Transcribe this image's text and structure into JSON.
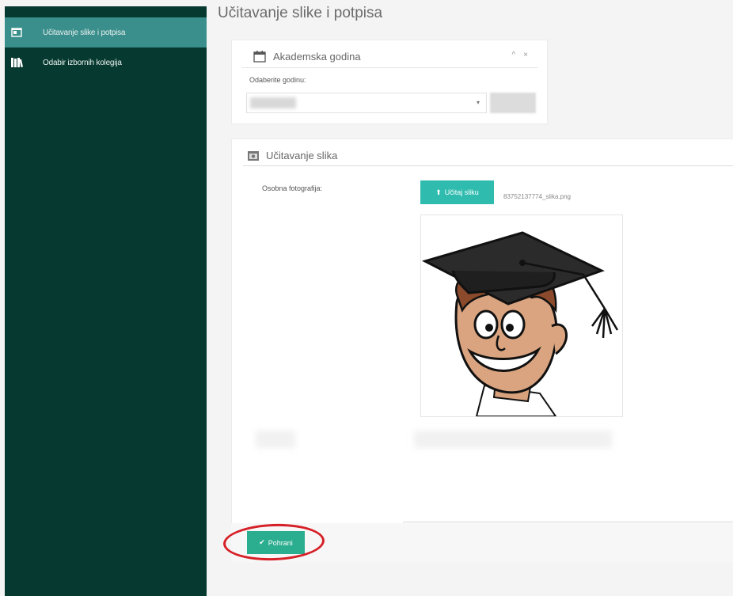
{
  "sidebar": {
    "items": [
      {
        "label": "Učitavanje slike i potpisa",
        "icon": "id-card-icon",
        "active": true
      },
      {
        "label": "Odabir izbornih kolegija",
        "icon": "books-icon",
        "active": false
      }
    ]
  },
  "page": {
    "title": "Učitavanje slike i potpisa"
  },
  "academic_year_panel": {
    "title": "Akademska godina",
    "icon": "calendar-icon",
    "controls": [
      "^",
      "×"
    ],
    "select_label": "Odaberite godinu:",
    "select_value": ""
  },
  "images_panel": {
    "title": "Učitavanje slika",
    "icon": "image-icon",
    "photo_label": "Osobna fotografija:",
    "upload_label": "Učitaj sliku",
    "filename": "83752137774_slika.png"
  },
  "footer": {
    "save_label": "Pohrani"
  },
  "colors": {
    "sidebar_bg": "#063a30",
    "sidebar_active": "#3a8f8c",
    "accent": "#2fbcaf",
    "save": "#2bad8f",
    "highlight": "#d61f26"
  }
}
